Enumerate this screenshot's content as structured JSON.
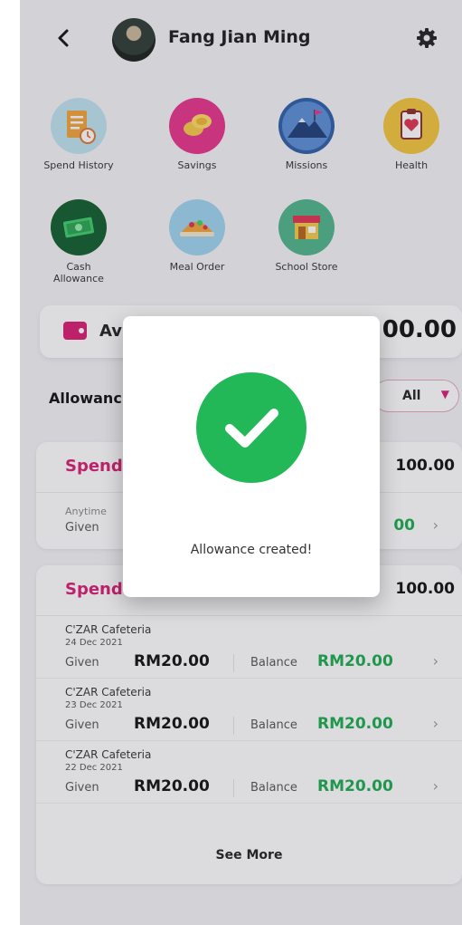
{
  "header": {
    "back_icon": "chevron-left-icon",
    "user_name": "Fang Jian Ming",
    "settings_icon": "gear-icon"
  },
  "menu": {
    "items": [
      {
        "label": "Spend History",
        "icon": "receipt-clock-icon",
        "color": "#7ec8e3"
      },
      {
        "label": "Savings",
        "icon": "coins-icon",
        "color": "#e8338a"
      },
      {
        "label": "Missions",
        "icon": "mountain-flag-icon",
        "color": "#2f5fa8"
      },
      {
        "label": "Health",
        "icon": "clipboard-heart-icon",
        "color": "#f3c53a"
      },
      {
        "label": "Cash Allowance",
        "icon": "cash-icon",
        "color": "#13703a"
      },
      {
        "label": "Meal Order",
        "icon": "meal-icon",
        "color": "#8cc8ea"
      },
      {
        "label": "School Store",
        "icon": "store-icon",
        "color": "#4fb58a"
      }
    ]
  },
  "balance": {
    "label": "Av",
    "amount": "00.00",
    "icon": "wallet-icon",
    "accent": "#d81b72"
  },
  "allowance_section": {
    "title": "Allowanc",
    "filter_value": "All"
  },
  "card1": {
    "title": "Spend",
    "total": "100.00",
    "line1": "Anytime",
    "line2": "Given",
    "balance": "00"
  },
  "card2": {
    "title": "Spend",
    "total": "100.00",
    "rows": [
      {
        "merchant": "C'ZAR Cafeteria",
        "date": "24 Dec 2021",
        "given_label": "Given",
        "given": "RM20.00",
        "balance_label": "Balance",
        "balance": "RM20.00"
      },
      {
        "merchant": "C'ZAR Cafeteria",
        "date": "23 Dec 2021",
        "given_label": "Given",
        "given": "RM20.00",
        "balance_label": "Balance",
        "balance": "RM20.00"
      },
      {
        "merchant": "C'ZAR Cafeteria",
        "date": "22 Dec 2021",
        "given_label": "Given",
        "given": "RM20.00",
        "balance_label": "Balance",
        "balance": "RM20.00"
      }
    ],
    "see_more": "See More"
  },
  "modal": {
    "icon": "check-circle-icon",
    "message": "Allowance created!",
    "success_color": "#22b858"
  },
  "colors": {
    "accent": "#d81b72",
    "positive": "#1aab4f"
  }
}
